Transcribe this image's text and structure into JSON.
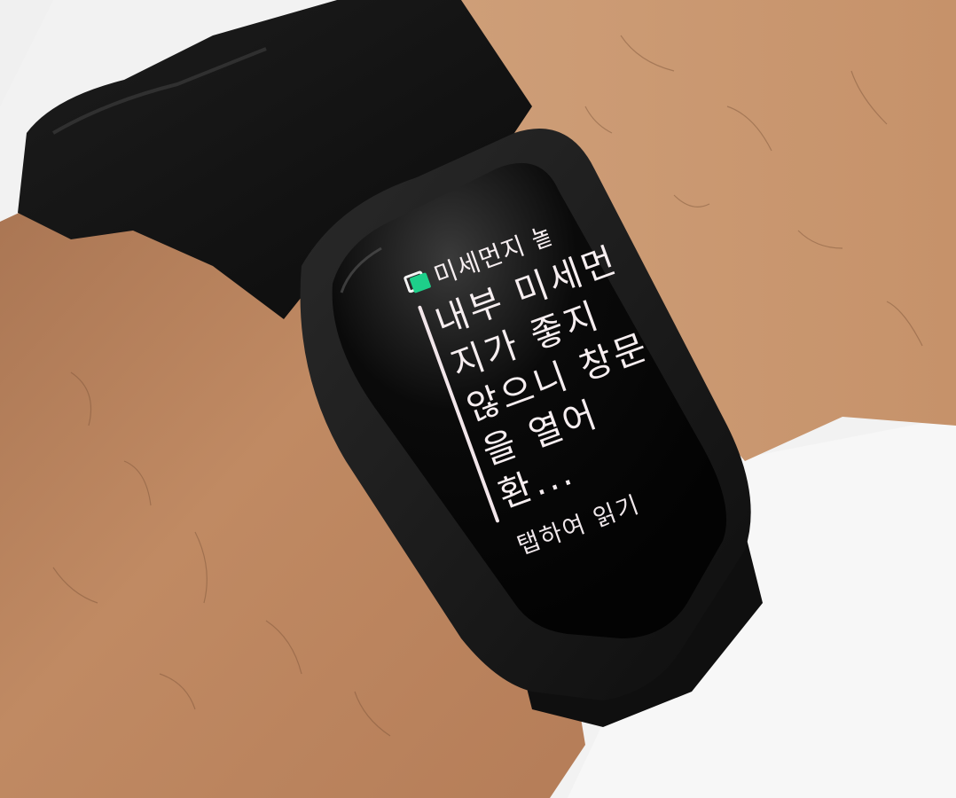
{
  "notification": {
    "app_icon": "messages-icon",
    "title": "미세먼지 놀",
    "body": "내부 미세먼지가 좋지 않으니 창문을 열어 환...",
    "cta": "탭하여 읽기"
  },
  "colors": {
    "screen_bg": "#050505",
    "text": "#f6eef0",
    "icon_accent": "#1ecf8a",
    "band": "#151515",
    "skin": "#b9845f"
  }
}
